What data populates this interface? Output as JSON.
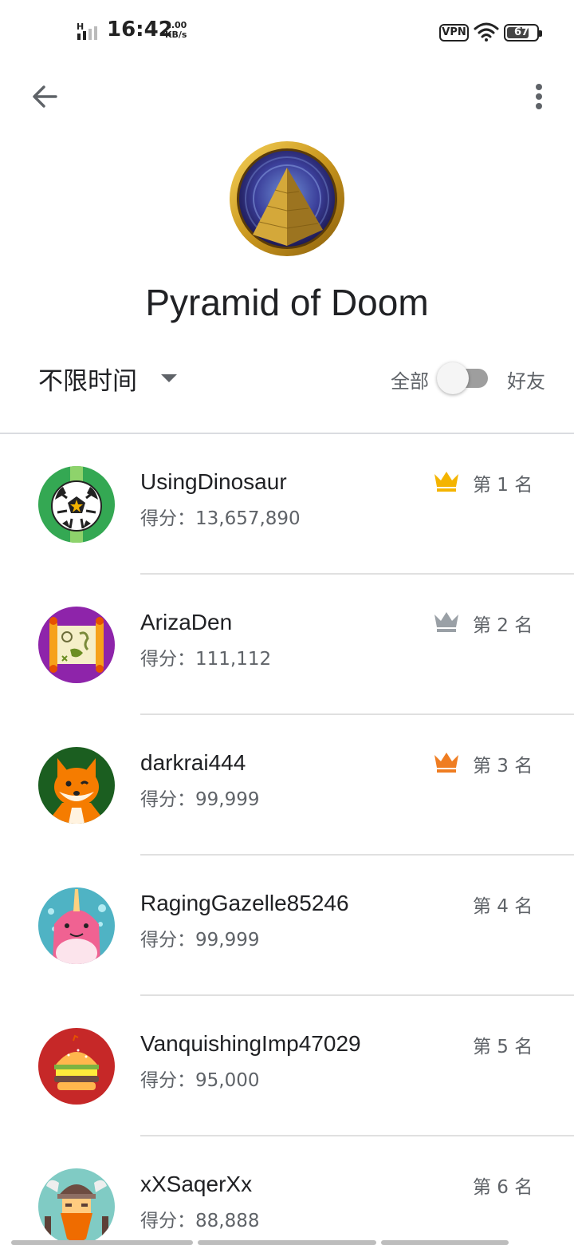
{
  "status_bar": {
    "signal_label": "H",
    "time": "16:42",
    "speed_value": "1.00",
    "speed_unit": "KB/s",
    "vpn": "VPN",
    "battery": "67"
  },
  "header": {
    "game_title": "Pyramid of Doom"
  },
  "filters": {
    "time_range": "不限时间",
    "scope_all": "全部",
    "scope_friends": "好友",
    "friends_only": false
  },
  "leaderboard": {
    "entries": [
      {
        "name": "UsingDinosaur",
        "score": "得分：13,657,890",
        "rank": "第 1 名",
        "crown": "gold",
        "avatar": "soccer-ball-avatar"
      },
      {
        "name": "ArizaDen",
        "score": "得分：111,112",
        "rank": "第 2 名",
        "crown": "silver",
        "avatar": "treasure-map-avatar"
      },
      {
        "name": "darkrai444",
        "score": "得分：99,999",
        "rank": "第 3 名",
        "crown": "bronze",
        "avatar": "fox-avatar"
      },
      {
        "name": "RagingGazelle85246",
        "score": "得分：99,999",
        "rank": "第 4 名",
        "crown": null,
        "avatar": "narwhal-avatar"
      },
      {
        "name": "VanquishingImp47029",
        "score": "得分：95,000",
        "rank": "第 5 名",
        "crown": null,
        "avatar": "burger-avatar"
      },
      {
        "name": "xXSaqerXx",
        "score": "得分：88,888",
        "rank": "第 6 名",
        "crown": null,
        "avatar": "viking-avatar"
      }
    ]
  },
  "colors": {
    "gold": "#f4b400",
    "silver": "#9aa0a6",
    "bronze": "#ef7d22"
  }
}
